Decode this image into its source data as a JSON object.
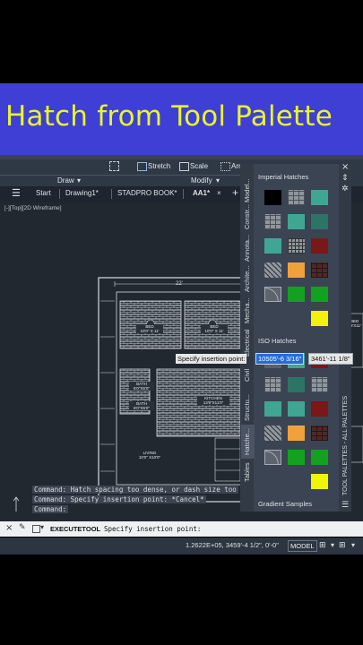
{
  "banner": {
    "text": "Hatch from Tool Palette"
  },
  "ribbon": {
    "stretch": "Stretch",
    "scale": "Scale",
    "array": "Arr",
    "draw_panel": "Draw",
    "modify_panel": "Modify"
  },
  "tabs": {
    "start": "Start",
    "drawing1": "Drawing1*",
    "stadpro": "STADPRO BOOK*",
    "aa1": "AA1*"
  },
  "viewport_label": "[-][Top][2D Wireframe]",
  "drawing": {
    "dim_22": "22'",
    "bed1": "BED\n10'0\" X 11'",
    "bed2": "BED\n10'0\" X 11'",
    "bath1": "BATH\n6'0\"X5'0\"",
    "bath2": "BATH\n6'0\"X5'0\"",
    "kitchen": "KITCHEN\n13'9\"X11'0\"",
    "living": "LIVING\n10'0\" X10'0\"",
    "bed_right": "BED\n9'X11'"
  },
  "palette": {
    "imperial": "Imperial Hatches",
    "iso": "ISO Hatches",
    "gradient": "Gradient Samples",
    "side_title": "TOOL PALETTES - ALL PALETTES",
    "vtabs": [
      "Model...",
      "Constr...",
      "Annota...",
      "Archite...",
      "Mecha...",
      "Electrical",
      "Civil",
      "Structu...",
      "Hatche...",
      "Tables"
    ],
    "imperial_swatches": [
      "black",
      "brick",
      "teal",
      "brick",
      "teal",
      "dark-teal",
      "teal",
      "grid",
      "dark-red",
      "stripe",
      "orange",
      "dark-tile",
      "curve",
      "green",
      "green",
      "yellow"
    ],
    "iso_swatches": [
      "gray",
      "teal",
      "dark-red",
      "brick",
      "dark-teal",
      "brick",
      "teal",
      "teal",
      "dark-red",
      "stripe",
      "orange",
      "dark-tile",
      "curve",
      "green",
      "green",
      "yellow"
    ]
  },
  "tooltip": {
    "label": "Specify insertion point:",
    "x_value": "10505'-6 3/16\"",
    "y_value": "3461'-11 1/8\""
  },
  "command_history": [
    "Command: Hatch spacing too dense, or dash size too",
    "Command:  Specify insertion point: *Cancel*",
    "Command:"
  ],
  "command_line": {
    "tool": "EXECUTETOOL",
    "prompt": "Specify insertion point:"
  },
  "status": {
    "coords": "1.2622E+05, 3459'-4 1/2\", 0'-0\"",
    "model": "MODEL"
  },
  "colors": {
    "banner": "#3f3fd6",
    "banner_text": "#e8f52a",
    "teal": "#3fa693",
    "dark_teal": "#2c7466",
    "dark_red": "#7a1717",
    "orange": "#f0a23a",
    "green": "#13a21f",
    "yellow": "#f2f20a"
  }
}
